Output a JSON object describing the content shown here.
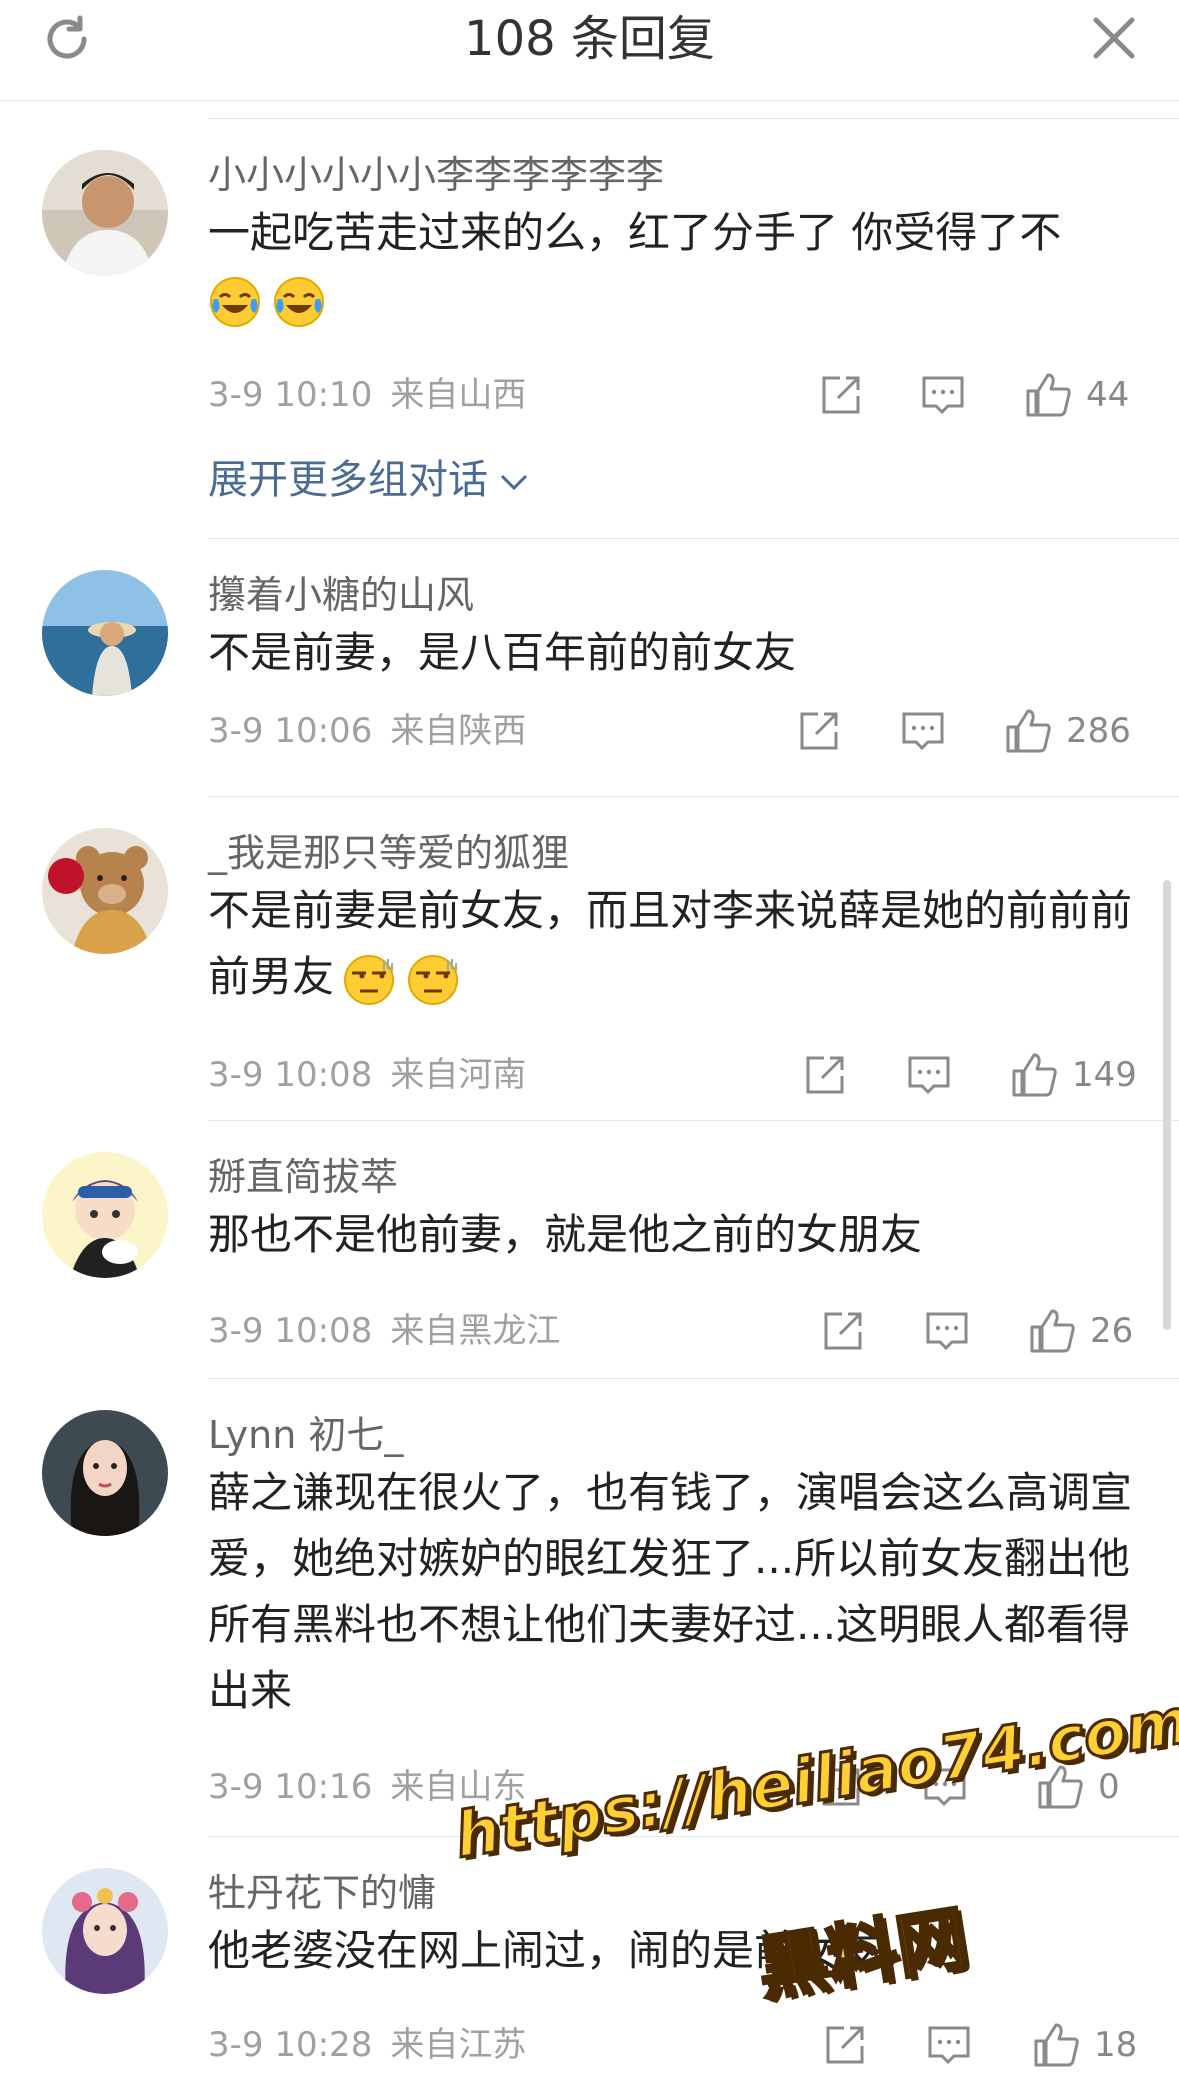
{
  "header": {
    "title": "108 条回复",
    "refresh_icon": "refresh-icon",
    "close_icon": "close-icon"
  },
  "comments": [
    {
      "username": "小小小小小小李李李李李李",
      "text": "一起吃苦走过来的么，红了分手了 你受得了不",
      "emojis": [
        "laugh-cry-emoji",
        "laugh-cry-emoji"
      ],
      "time": "3-9 10:10",
      "location": "来自山西",
      "likes": "44",
      "expand": "展开更多组对话"
    },
    {
      "username": "攥着小糖的山风",
      "text": "不是前妻，是八百年前的前女友",
      "emojis": [],
      "time": "3-9 10:06",
      "location": "来自陕西",
      "likes": "286"
    },
    {
      "username": "_我是那只等爱的狐狸",
      "text": "不是前妻是前女友，而且对李来说薛是她的前前前前男友",
      "emojis": [
        "side-eye-emoji",
        "side-eye-emoji"
      ],
      "time": "3-9 10:08",
      "location": "来自河南",
      "likes": "149"
    },
    {
      "username": "掰直简拔萃",
      "text": "那也不是他前妻，就是他之前的女朋友",
      "emojis": [],
      "time": "3-9 10:08",
      "location": "来自黑龙江",
      "likes": "26"
    },
    {
      "username": "Lynn 初七_",
      "text": "薛之谦现在很火了，也有钱了，演唱会这么高调宣爱，她绝对嫉妒的眼红发狂了...所以前女友翻出他所有黑料也不想让他们夫妻好过...这明眼人都看得出来",
      "emojis": [],
      "time": "3-9 10:16",
      "location": "来自山东",
      "likes": "0"
    },
    {
      "username": "牡丹花下的慵",
      "text": "他老婆没在网上闹过，闹的是前女友。",
      "emojis": [],
      "time": "3-9 10:28",
      "location": "来自江苏",
      "likes": "18"
    }
  ],
  "watermark": {
    "url": "https://heiliao74.com",
    "site": "黑料网"
  },
  "colors": {
    "link": "#4a6b94",
    "meta": "#a0a0a0",
    "watermark": "#ffcf33"
  }
}
